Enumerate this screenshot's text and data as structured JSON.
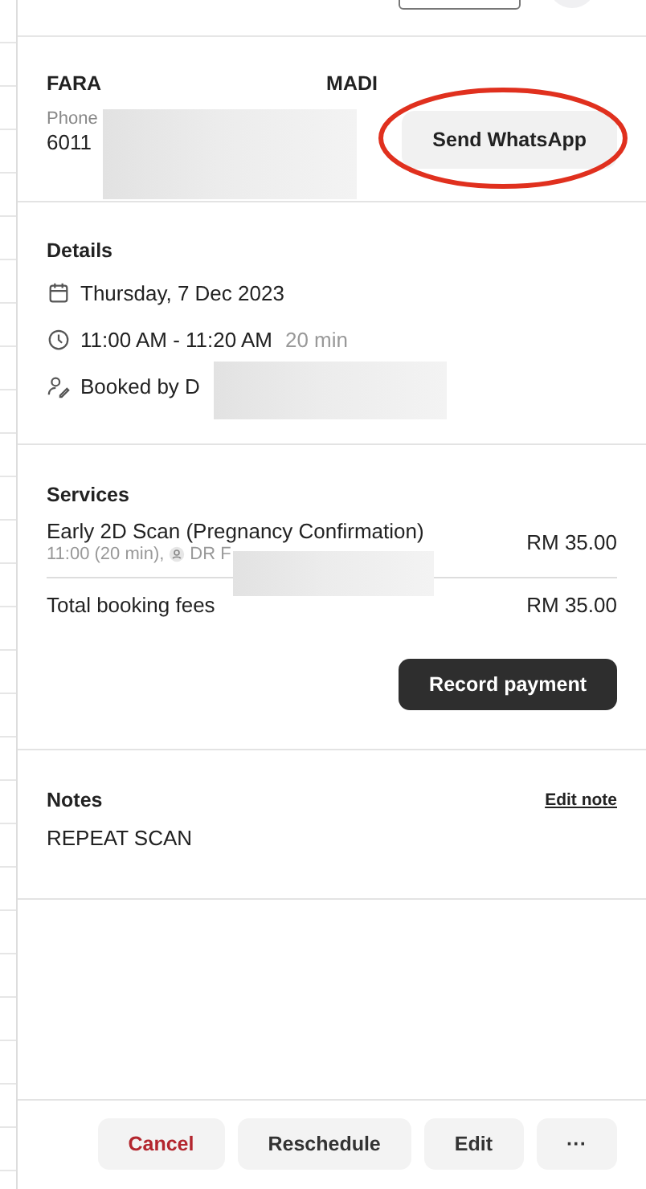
{
  "client": {
    "name_start": "FARA",
    "name_end": "MADI",
    "phone_label": "Phone",
    "phone_value": "6011",
    "whatsapp_button": "Send WhatsApp",
    "highlighted": true
  },
  "details": {
    "title": "Details",
    "date": "Thursday, 7 Dec 2023",
    "time": "11:00 AM - 11:20 AM",
    "duration": "20 min",
    "booked_by": "Booked by D"
  },
  "services": {
    "title": "Services",
    "items": [
      {
        "name": "Early 2D Scan (Pregnancy Confirmation)",
        "meta": "11:00 (20 min),",
        "staff": "DR F",
        "price": "RM 35.00"
      }
    ],
    "total_label": "Total booking fees",
    "total_value": "RM 35.00",
    "payment_button": "Record payment"
  },
  "notes": {
    "title": "Notes",
    "edit_link": "Edit note",
    "text": "REPEAT SCAN"
  },
  "footer_buttons": [
    {
      "label": "Cancel",
      "kind": "danger"
    },
    {
      "label": "Reschedule",
      "kind": "default"
    },
    {
      "label": "Edit",
      "kind": "default"
    },
    {
      "label": "···",
      "kind": "default"
    }
  ]
}
